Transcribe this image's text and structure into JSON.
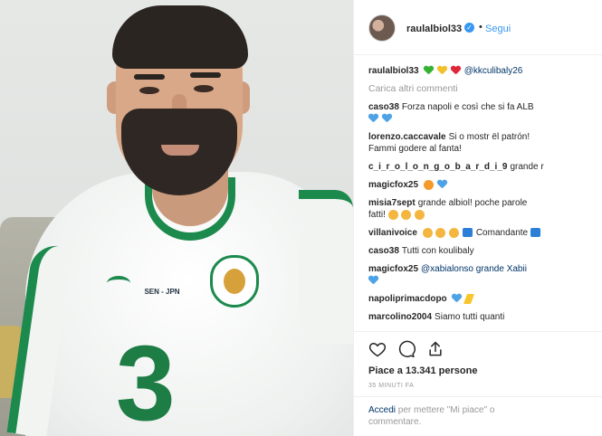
{
  "photo": {
    "jersey_match_text": "SEN - JPN",
    "jersey_number": "3"
  },
  "header": {
    "username": "raulalbiol33",
    "verified": true,
    "separator": "•",
    "follow_label": "Segui"
  },
  "caption": {
    "username": "raulalbiol33",
    "hearts": [
      "green-heart",
      "yellow-heart",
      "red-heart"
    ],
    "mention": "@kkculibaly26"
  },
  "load_more_label": "Carica altri commenti",
  "comments": [
    {
      "user": "caso38",
      "text": "Forza napoli e così che si fa ALB",
      "emoji": [],
      "second_line_emoji": [
        "blue-heart",
        "blue-heart"
      ]
    },
    {
      "user": "lorenzo.caccavale",
      "text": "Si o mostr ël patrón!",
      "second_line_text": "Fammi godere al fanta!",
      "emoji": []
    },
    {
      "user": "c_i_r_o_l_o_n_g_o_b_a_r_d_i_9",
      "text": "grande r",
      "emoji": []
    },
    {
      "user": "magicfox25",
      "text": "",
      "emoji": [
        "star-eyes-emoji",
        "blue-heart"
      ]
    },
    {
      "user": "misia7sept",
      "text": "grande albiol! poche parole",
      "second_line_text": "fatti!",
      "second_line_emoji": [
        "clap-emoji",
        "clap-emoji",
        "clap-emoji"
      ],
      "emoji": []
    },
    {
      "user": "villanivoice",
      "text": "Comandante",
      "emoji": [
        "clap-emoji",
        "clap-emoji",
        "clap-emoji",
        "flag-emoji"
      ],
      "trailing_emoji": [
        "flag-emoji"
      ]
    },
    {
      "user": "caso38",
      "text": "Tutti con koulibaly",
      "emoji": []
    },
    {
      "user": "magicfox25",
      "text": "@xabialonso grande Xabii",
      "second_line_emoji": [
        "blue-heart"
      ],
      "emoji": []
    },
    {
      "user": "napoliprimacdopo",
      "text": "",
      "emoji": [
        "blue-heart",
        "zap-emoji"
      ]
    },
    {
      "user": "marcolino2004",
      "text": "Siamo tutti quanti",
      "emoji": []
    }
  ],
  "actions": {
    "like_icon": "heart-outline-icon",
    "comment_icon": "comment-bubble-icon",
    "share_icon": "share-arrow-icon"
  },
  "likes_text": "Piace a 13.341 persone",
  "time_text": "35 MINUTI FA",
  "login": {
    "link_text": "Accedi",
    "rest_text": " per mettere \"Mi piace\" o commentare."
  },
  "colors": {
    "link_blue": "#3897f0",
    "mention_blue": "#003569",
    "muted_gray": "#999999",
    "jersey_green": "#1d8a4d"
  }
}
